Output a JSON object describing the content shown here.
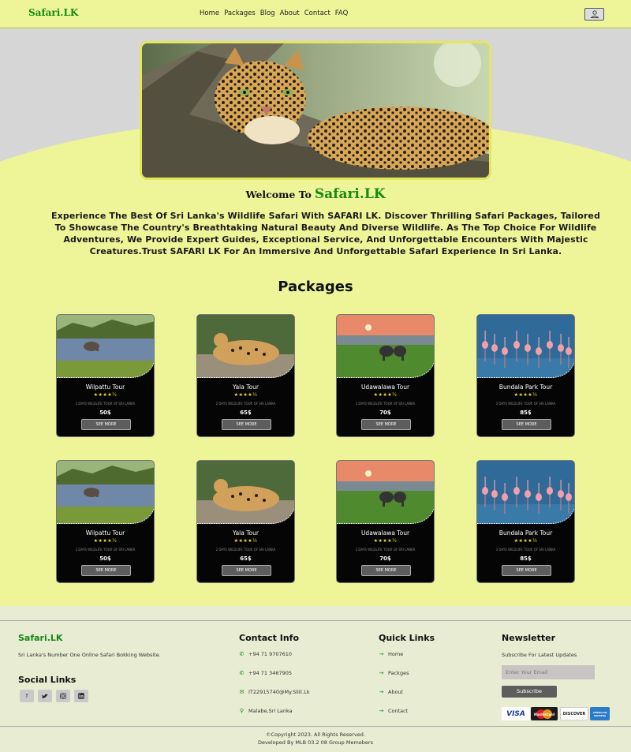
{
  "nav": {
    "brand": "Safari.LK",
    "links": [
      "Home",
      "Packages",
      "Blog",
      "About",
      "Contact",
      "FAQ"
    ],
    "user_icon": "user-icon"
  },
  "hero": {
    "image": "leopard-on-tree",
    "welcome_prefix": "Welcome To",
    "welcome_brand": "Safari.LK",
    "intro": "Experience The Best Of Sri Lanka's Wildlife Safari With SAFARI LK. Discover Thrilling Safari Packages, Tailored To Showcase The Country's Breathtaking Natural Beauty And Diverse Wildlife. As The Top Choice For Wildlife Adventures, We Provide Expert Guides, Exceptional Service, And Unforgettable Encounters With Majestic Creatures.Trust SAFARI LK For An Immersive And Unforgettable Safari Experience In Sri Lanka."
  },
  "packages": {
    "title": "Packages",
    "button_label": "SEE MORE",
    "rows": [
      [
        {
          "name": "Wilpattu Tour",
          "stars": "★★★★½",
          "desc": "2 DAYS WILDLIFE TOUR OF SRI LANKA",
          "price": "50$",
          "image": "elephant-in-lake"
        },
        {
          "name": "Yala Tour",
          "stars": "★★★★½",
          "desc": "2 DAYS WILDLIFE TOUR OF SRI LANKA",
          "price": "65$",
          "image": "leopard-on-rock"
        },
        {
          "name": "Udawalawa Tour",
          "stars": "★★★★½",
          "desc": "2 DAYS WILDLIFE TOUR OF SRI LANKA",
          "price": "70$",
          "image": "elephants-at-sunset"
        },
        {
          "name": "Bundala Park Tour",
          "stars": "★★★★½",
          "desc": "3 DAYS WILDLIFE TOUR OF SRI LANKA",
          "price": "85$",
          "image": "flamingos-in-water"
        }
      ],
      [
        {
          "name": "Wilpattu Tour",
          "stars": "★★★★½",
          "desc": "2 DAYS WILDLIFE TOUR OF SRI LANKA",
          "price": "50$",
          "image": "elephant-in-lake"
        },
        {
          "name": "Yala Tour",
          "stars": "★★★★½",
          "desc": "2 DAYS WILDLIFE TOUR OF SRI LANKA",
          "price": "65$",
          "image": "leopard-on-rock"
        },
        {
          "name": "Udawalawa Tour",
          "stars": "★★★★½",
          "desc": "2 DAYS WILDLIFE TOUR OF SRI LANKA",
          "price": "70$",
          "image": "elephants-at-sunset"
        },
        {
          "name": "Bundala Park Tour",
          "stars": "★★★★½",
          "desc": "3 DAYS WILDLIFE TOUR OF SRI LANKA",
          "price": "85$",
          "image": "flamingos-in-water"
        }
      ]
    ]
  },
  "footer": {
    "brand": "Safari.LK",
    "tagline": "Sri Lanka's Number One Online Safari Bokking Website.",
    "social_heading": "Social Links",
    "social_icons": [
      "facebook-icon",
      "twitter-icon",
      "instagram-icon",
      "linkedin-icon"
    ],
    "contact": {
      "heading": "Contact Info",
      "phone1": "+94 71 9707610",
      "phone2": "+94 71 3467905",
      "email": "IT22915740@My.Sliit.Lk",
      "address": "Malabe,Sri Lanka"
    },
    "quick_links": {
      "heading": "Quick Links",
      "items": [
        "Home",
        "Packges",
        "About",
        "Contact"
      ]
    },
    "newsletter": {
      "heading": "Newsletter",
      "subtitle": "Subscribe For Latest Updates",
      "placeholder": "Enter Your Email",
      "button": "Subscribe"
    },
    "payments": [
      "VISA",
      "MasterCard",
      "DISCOVER",
      "AMERICAN EXPRESS"
    ],
    "copyright": "©Copyright 2023. All Rights Reserved.",
    "developed": "Developed By MLB 03.2 08 Group Memebers"
  },
  "colors": {
    "accent": "#168a16",
    "page_bg": "#edf598",
    "card_bg": "#050505",
    "footer_bg": "#e7ecd2"
  }
}
